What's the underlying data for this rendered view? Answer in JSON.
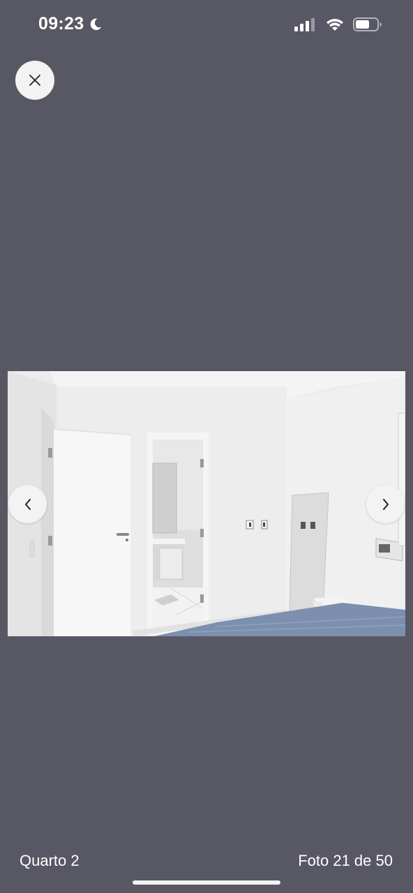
{
  "status_bar": {
    "time": "09:23",
    "icons": [
      "moon-icon",
      "signal-icon",
      "wifi-icon",
      "battery-icon"
    ]
  },
  "viewer": {
    "close_icon": "close-icon",
    "prev_icon": "chevron-left-icon",
    "next_icon": "chevron-right-icon",
    "caption": "Quarto 2",
    "counter": "Foto 21 de 50",
    "current_photo": 21,
    "total_photos": 50
  },
  "colors": {
    "background": "#585864",
    "button_bg": "#f3f3f3",
    "text": "#ffffff"
  }
}
